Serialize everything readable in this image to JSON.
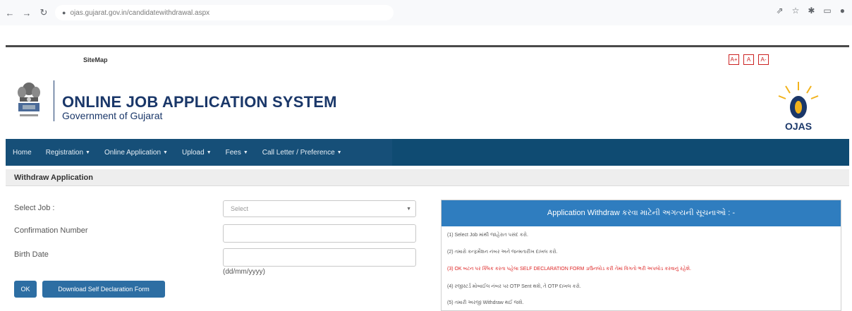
{
  "browser": {
    "url": "ojas.gujarat.gov.in/candidatewithdrawal.aspx"
  },
  "topbar": {
    "sitemap": "SiteMap",
    "font_buttons": [
      "A+",
      "A",
      "A-"
    ]
  },
  "header": {
    "title": "ONLINE JOB APPLICATION SYSTEM",
    "subtitle": "Government of Gujarat",
    "logo_text": "OJAS"
  },
  "nav": {
    "items": [
      {
        "label": "Home",
        "dropdown": false
      },
      {
        "label": "Registration",
        "dropdown": true
      },
      {
        "label": "Online Application",
        "dropdown": true
      },
      {
        "label": "Upload",
        "dropdown": true
      },
      {
        "label": "Fees",
        "dropdown": true
      },
      {
        "label": "Call Letter / Preference",
        "dropdown": true
      }
    ]
  },
  "page": {
    "title": "Withdraw Application"
  },
  "form": {
    "select_job_label": "Select Job :",
    "select_job_value": "Select",
    "confirmation_label": "Confirmation Number",
    "birth_date_label": "Birth Date",
    "date_hint": "(dd/mm/yyyy)",
    "ok_button": "OK",
    "download_button": "Download Self Declaration Form"
  },
  "panel": {
    "title": "Application Withdraw કરવા માટેની અગત્યની સૂચનાઓ : -",
    "lines": [
      {
        "text": "(1) Select Job માંથી જાહેરાત પસંદ કરો.",
        "red": false
      },
      {
        "text": "(2) તમારો કન્ફર્મેશન નંબર અને જન્મતારીખ દાખલ કરો.",
        "red": false
      },
      {
        "text": "(3) OK બટન પર ક્લિક કરતા પહેલા SELF DECLARATION FORM ડાઉનલોડ કરી તેમાં વિગતો ભરી અપલોડ કરવાનું રહેશે.",
        "red": true
      },
      {
        "text": "(4) રજીસ્ટર્ડ મોબાઈલ નંબર પર OTP Sent થશે, તે OTP દાખલ કરો.",
        "red": false
      },
      {
        "text": "(5) તમારી અરજી Withdraw થઈ જશે.",
        "red": false
      }
    ]
  },
  "colors": {
    "navbar": "#0f4b72",
    "title": "#1a3769",
    "panel_header": "#2f7dbf",
    "button": "#2d6ea3",
    "alert_red": "#d22222"
  },
  "icons": {
    "back": "arrow-left-icon",
    "forward": "arrow-right-icon",
    "reload": "reload-icon",
    "lock": "lock-icon",
    "share": "share-icon",
    "star": "star-icon",
    "extension": "puzzle-icon",
    "sidebar": "sidebar-icon",
    "profile": "profile-icon"
  }
}
